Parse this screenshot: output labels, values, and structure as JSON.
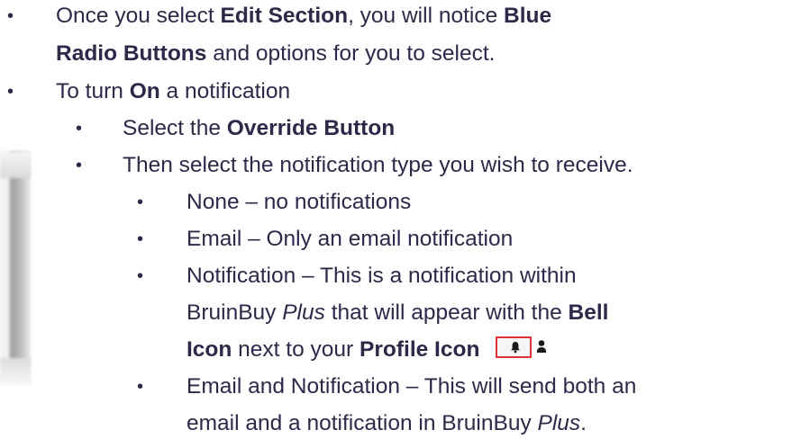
{
  "bullet_char": "•",
  "items": {
    "l1_a_pre": "Once you select ",
    "l1_a_b1": "Edit Section",
    "l1_a_mid": ", you will notice ",
    "l1_a_b2": "Blue",
    "l1_b_b": "Radio Buttons",
    "l1_b_post": " and options for you to select.",
    "l2_pre": "To turn ",
    "l2_b": "On",
    "l2_post": " a notification",
    "l3_pre": "Select the ",
    "l3_b": "Override Button",
    "l4": "Then select the notification type you wish to receive.",
    "l5": "None – no notifications",
    "l6": "Email – Only an email notification",
    "l7": "Notification – This is a notification within",
    "l8_pre": "BruinBuy ",
    "l8_i": "Plus",
    "l8_mid": " that will appear with the ",
    "l8_b": "Bell",
    "l9_b1": "Icon",
    "l9_mid": " next to your ",
    "l9_b2": "Profile Icon",
    "l10": "Email and Notification – This will send both an",
    "l11_pre": "email and a notification in BruinBuy ",
    "l11_i": "Plus",
    "l11_post": "."
  },
  "icons": {
    "bell": "bell-icon",
    "profile": "profile-icon",
    "highlight_color": "#e0313a"
  }
}
